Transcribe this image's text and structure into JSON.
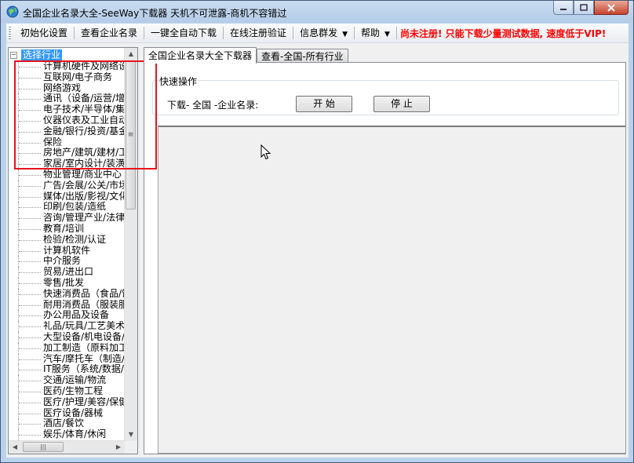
{
  "window": {
    "title": "全国企业名录大全-SeeWay下载器  天机不可泄露-商机不容错过"
  },
  "menu": {
    "items": [
      "初始化设置",
      "查看企业名录",
      "一键全自动下载",
      "在线注册验证",
      "信息群发",
      "帮助"
    ],
    "notice": "尚未注册! 只能下载少量测试数据, 速度低于VIP!"
  },
  "tree": {
    "root_label": "选择行业",
    "items": [
      "计算机硬件及网络设备",
      "互联网/电子商务",
      "网络游戏",
      "通讯（设备/运营/增值服务）",
      "电子技术/半导体/集成电路",
      "仪器仪表及工业自动化",
      "金融/银行/投资/基金/证券",
      "保险",
      "房地产/建筑/建材/工程",
      "家居/室内设计/装潢",
      "物业管理/商业中心",
      "广告/会展/公关/市场推广",
      "媒体/出版/影视/文化传播",
      "印刷/包装/造纸",
      "咨询/管理产业/法律/财会",
      "教育/培训",
      "检验/检测/认证",
      "计算机软件",
      "中介服务",
      "贸易/进出口",
      "零售/批发",
      "快速消费品（食品/饮料）",
      "耐用消费品（服装服饰）",
      "办公用品及设备",
      "礼品/玩具/工艺美术/收藏品",
      "大型设备/机电设备/重工业",
      "加工制造（原料加工/模具）",
      "汽车/摩托车（制造/维护/配件）",
      "IT服务（系统/数据/维护）",
      "交通/运输/物流",
      "医药/生物工程",
      "医疗/护理/美容/保健",
      "医疗设备/器械",
      "酒店/餐饮",
      "娱乐/体育/休闲"
    ]
  },
  "tabs": [
    {
      "label": "全国企业名录大全下载器"
    },
    {
      "label": "查看-全国-所有行业"
    }
  ],
  "quick": {
    "group_title": "快速操作",
    "download_label": "下载- 全国 -企业名录:",
    "start_button": "开  始",
    "stop_button": "停  止"
  },
  "colors": {
    "accent_selection": "#3399ff",
    "notice_red": "#ff0000",
    "highlight_box": "#e8141c"
  },
  "icons": [
    "app-globe-icon",
    "minimize-icon",
    "maximize-icon",
    "close-icon",
    "mouse-cursor-icon"
  ]
}
